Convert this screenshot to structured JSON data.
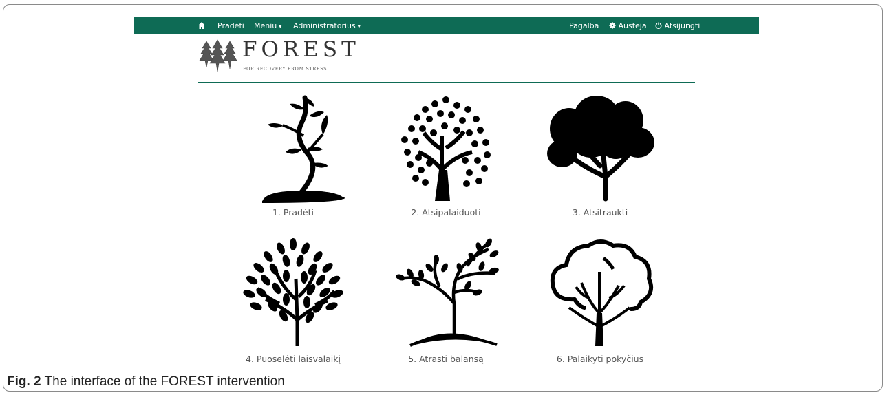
{
  "navbar": {
    "home_icon": "home-icon",
    "left_items": [
      "Pradėti",
      "Meniu",
      "Administratorius"
    ],
    "right_items": {
      "help": "Pagalba",
      "user": "Austeja",
      "logout": "Atsijungti"
    },
    "user_icon": "gear-icon",
    "logout_icon": "power-icon",
    "color": "#0e6b55"
  },
  "brand": {
    "title": "FOREST",
    "subtitle": "FOR RECOVERY FROM STRESS"
  },
  "tiles": [
    {
      "label": "1. Pradėti",
      "icon": "tree-sapling-icon"
    },
    {
      "label": "2. Atsipalaiduoti",
      "icon": "tree-dots-icon"
    },
    {
      "label": "3. Atsitraukti",
      "icon": "tree-cloud-icon"
    },
    {
      "label": "4. Puoselėti laisvalaikį",
      "icon": "tree-leafy-icon"
    },
    {
      "label": "5. Atrasti balansą",
      "icon": "tree-branching-icon"
    },
    {
      "label": "6. Palaikyti pokyčius",
      "icon": "tree-outline-icon"
    }
  ],
  "caption": {
    "label": "Fig. 2",
    "text": " The interface of the FOREST intervention"
  }
}
